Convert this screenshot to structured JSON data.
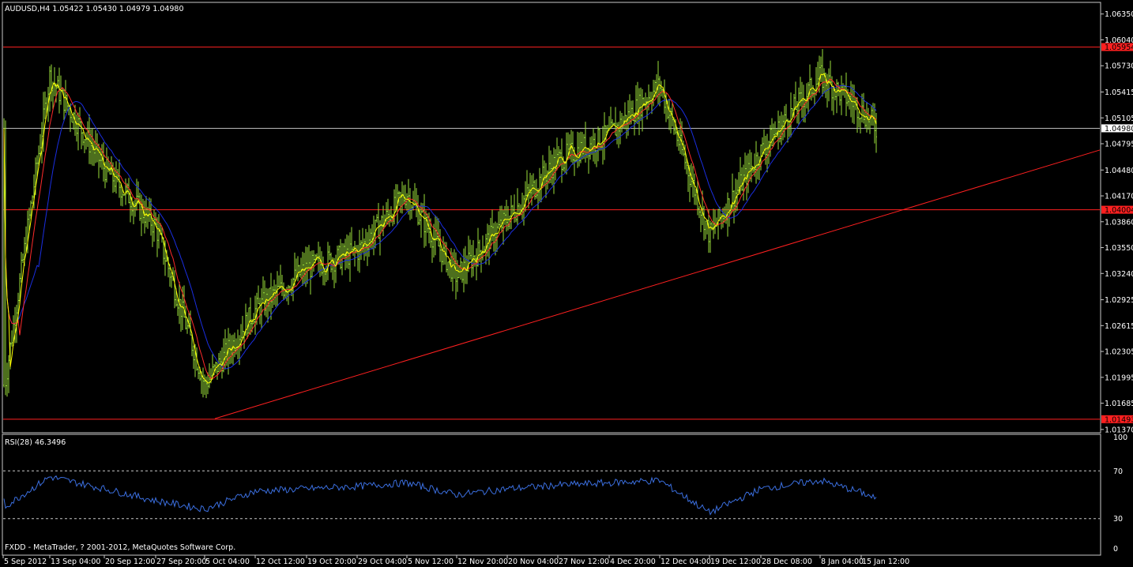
{
  "header": {
    "symbol_line": "AUDUSD,H4  1.05422 1.05430 1.04979 1.04980"
  },
  "rsi_panel": {
    "label": "RSI(28) 46.3496",
    "levels": [
      70,
      30
    ],
    "scale_labels": [
      "100",
      "70",
      "30",
      "0"
    ],
    "line_color": "#3b6fe0",
    "level_color": "#c8c8c8"
  },
  "footer": {
    "copyright": "FXDD - MetaTrader, ? 2001-2012, MetaQuotes Software Corp."
  },
  "colors": {
    "background": "#000000",
    "axis": "#c8c8c8",
    "bars": "#9ade3a",
    "ma_fast": "#ff2a2a",
    "ma_mid": "#ffff00",
    "ma_slow": "#1a2ee0",
    "hlines": "#ff2020",
    "trendline": "#ff2020",
    "current_price_line": "#b8b8b8"
  },
  "chart_data": {
    "type": "line",
    "title": "AUDUSD,H4  1.05422 1.05430 1.04979 1.04980",
    "y_axis_ticks": [
      "1.06350",
      "1.06040",
      "1.05730",
      "1.05415",
      "1.05105",
      "1.04795",
      "1.04480",
      "1.04170",
      "1.03860",
      "1.03550",
      "1.03240",
      "1.02925",
      "1.02615",
      "1.02305",
      "1.01995",
      "1.01685",
      "1.01370"
    ],
    "ylim": [
      1.0134,
      1.0648
    ],
    "x_axis_ticks": [
      "5 Sep 2012",
      "13 Sep 04:00",
      "20 Sep 12:00",
      "27 Sep 20:00",
      "5 Oct 04:00",
      "12 Oct 12:00",
      "19 Oct 20:00",
      "29 Oct 04:00",
      "5 Nov 12:00",
      "12 Nov 20:00",
      "20 Nov 04:00",
      "27 Nov 12:00",
      "4 Dec 20:00",
      "12 Dec 04:00",
      "19 Dec 12:00",
      "28 Dec 08:00",
      "8 Jan 04:00",
      "15 Jan 12:00"
    ],
    "horizontal_lines": [
      {
        "price": 1.05954,
        "label": "1.05954"
      },
      {
        "price": 1.04004,
        "label": "1.04004"
      },
      {
        "price": 1.01493,
        "label": "1.01493"
      }
    ],
    "current_price": {
      "price": 1.0498,
      "label": "1.04980"
    },
    "trendline": {
      "from": {
        "x": "5 Oct 04:00",
        "price": 1.015
      },
      "to": {
        "x": "beyond 15 Jan 12:00",
        "price": 1.0472
      }
    },
    "series": [
      {
        "x": [
          "5 Sep 2012",
          "13 Sep 04:00",
          "20 Sep 12:00",
          "27 Sep 20:00",
          "5 Oct 04:00",
          "12 Oct 12:00",
          "19 Oct 20:00",
          "29 Oct 04:00",
          "5 Nov 12:00",
          "12 Nov 20:00",
          "20 Nov 04:00",
          "27 Nov 12:00",
          "4 Dec 20:00",
          "12 Dec 04:00",
          "19 Dec 12:00",
          "28 Dec 08:00",
          "8 Jan 04:00",
          "15 Jan 12:00"
        ],
        "values": [
          1.019,
          1.056,
          1.045,
          1.038,
          1.019,
          1.028,
          1.033,
          1.035,
          1.042,
          1.032,
          1.039,
          1.046,
          1.049,
          1.055,
          1.037,
          1.047,
          1.056,
          1.052
        ]
      }
    ],
    "rsi": {
      "label": "RSI(28) 46.3496",
      "ylim": [
        0,
        100
      ],
      "levels": [
        70,
        30
      ],
      "x": [
        "5 Sep 2012",
        "13 Sep 04:00",
        "20 Sep 12:00",
        "27 Sep 20:00",
        "5 Oct 04:00",
        "12 Oct 12:00",
        "19 Oct 20:00",
        "29 Oct 04:00",
        "5 Nov 12:00",
        "12 Nov 20:00",
        "20 Nov 04:00",
        "27 Nov 12:00",
        "4 Dec 20:00",
        "12 Dec 04:00",
        "19 Dec 12:00",
        "28 Dec 08:00",
        "8 Jan 04:00",
        "15 Jan 12:00"
      ],
      "values": [
        40,
        65,
        55,
        45,
        38,
        53,
        55,
        57,
        60,
        50,
        55,
        58,
        60,
        62,
        35,
        55,
        62,
        52
      ]
    }
  }
}
